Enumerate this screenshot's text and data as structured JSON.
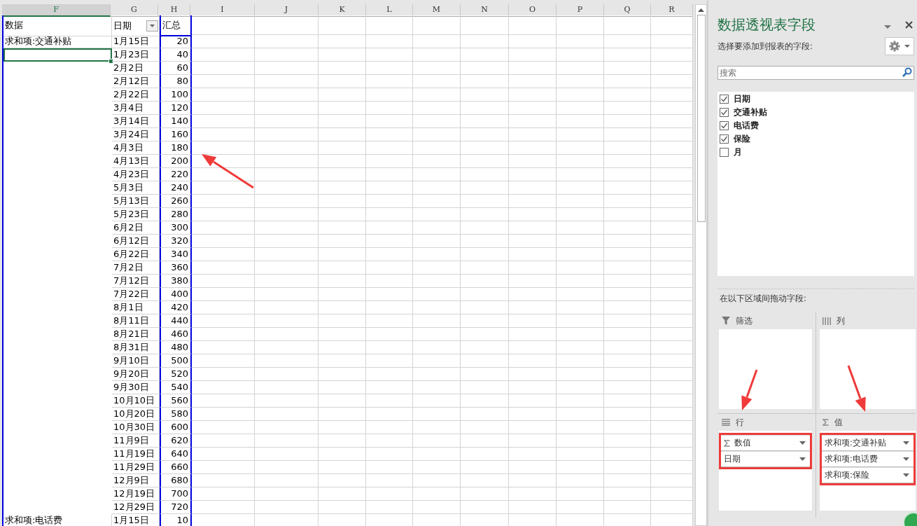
{
  "sheet": {
    "columns": [
      {
        "label": "F",
        "selected": true
      },
      {
        "label": "G",
        "selected": false
      },
      {
        "label": "H",
        "selected": false
      },
      {
        "label": "I",
        "selected": false
      },
      {
        "label": "J",
        "selected": false
      },
      {
        "label": "K",
        "selected": false
      },
      {
        "label": "L",
        "selected": false
      },
      {
        "label": "M",
        "selected": false
      },
      {
        "label": "N",
        "selected": false
      },
      {
        "label": "O",
        "selected": false
      },
      {
        "label": "P",
        "selected": false
      },
      {
        "label": "Q",
        "selected": false
      },
      {
        "label": "R",
        "selected": false
      }
    ],
    "header": {
      "data_label": "数据",
      "date_label": "日期",
      "total_label": "汇总"
    },
    "total_column_highlighted": true,
    "groups": [
      {
        "label": "求和项:交通补贴",
        "selected": true,
        "rows": [
          {
            "date": "1月15日",
            "total": "20"
          },
          {
            "date": "1月23日",
            "total": "40"
          },
          {
            "date": "2月2日",
            "total": "60"
          },
          {
            "date": "2月12日",
            "total": "80"
          },
          {
            "date": "2月22日",
            "total": "100"
          },
          {
            "date": "3月4日",
            "total": "120"
          },
          {
            "date": "3月14日",
            "total": "140"
          },
          {
            "date": "3月24日",
            "total": "160"
          },
          {
            "date": "4月3日",
            "total": "180"
          },
          {
            "date": "4月13日",
            "total": "200"
          },
          {
            "date": "4月23日",
            "total": "220"
          },
          {
            "date": "5月3日",
            "total": "240"
          },
          {
            "date": "5月13日",
            "total": "260"
          },
          {
            "date": "5月23日",
            "total": "280"
          },
          {
            "date": "6月2日",
            "total": "300"
          },
          {
            "date": "6月12日",
            "total": "320"
          },
          {
            "date": "6月22日",
            "total": "340"
          },
          {
            "date": "7月2日",
            "total": "360"
          },
          {
            "date": "7月12日",
            "total": "380"
          },
          {
            "date": "7月22日",
            "total": "400"
          },
          {
            "date": "8月1日",
            "total": "420"
          },
          {
            "date": "8月11日",
            "total": "440"
          },
          {
            "date": "8月21日",
            "total": "460"
          },
          {
            "date": "8月31日",
            "total": "480"
          },
          {
            "date": "9月10日",
            "total": "500"
          },
          {
            "date": "9月20日",
            "total": "520"
          },
          {
            "date": "9月30日",
            "total": "540"
          },
          {
            "date": "10月10日",
            "total": "560"
          },
          {
            "date": "10月20日",
            "total": "580"
          },
          {
            "date": "10月30日",
            "total": "600"
          },
          {
            "date": "11月9日",
            "total": "620"
          },
          {
            "date": "11月19日",
            "total": "640"
          },
          {
            "date": "11月29日",
            "total": "660"
          },
          {
            "date": "12月9日",
            "total": "680"
          },
          {
            "date": "12月19日",
            "total": "700"
          },
          {
            "date": "12月29日",
            "total": "720"
          }
        ]
      },
      {
        "label": "求和项:电话费",
        "selected": false,
        "rows": [
          {
            "date": "1月15日",
            "total": "10"
          }
        ]
      }
    ]
  },
  "panel": {
    "title": "数据透视表字段",
    "subtitle": "选择要添加到报表的字段:",
    "search": {
      "placeholder": "搜索"
    },
    "fields": [
      {
        "label": "日期",
        "checked": true
      },
      {
        "label": "交通补贴",
        "checked": true
      },
      {
        "label": "电话费",
        "checked": true
      },
      {
        "label": "保险",
        "checked": true
      },
      {
        "label": "月",
        "checked": false
      }
    ],
    "areas_hint": "在以下区域间拖动字段:",
    "areas": [
      {
        "kind": "filter",
        "label": "筛选",
        "highlighted": false
      },
      {
        "kind": "columns",
        "label": "列",
        "highlighted": false
      },
      {
        "kind": "rows",
        "label": "行",
        "highlighted": true,
        "items": [
          {
            "kind": "sigma",
            "label": "数值"
          },
          {
            "kind": "field",
            "label": "日期"
          }
        ]
      },
      {
        "kind": "values",
        "label": "值",
        "highlighted": true,
        "items": [
          {
            "kind": "field",
            "label": "求和项:交通补贴"
          },
          {
            "kind": "field",
            "label": "求和项:电话费"
          },
          {
            "kind": "field",
            "label": "求和项:保险"
          }
        ]
      }
    ]
  }
}
